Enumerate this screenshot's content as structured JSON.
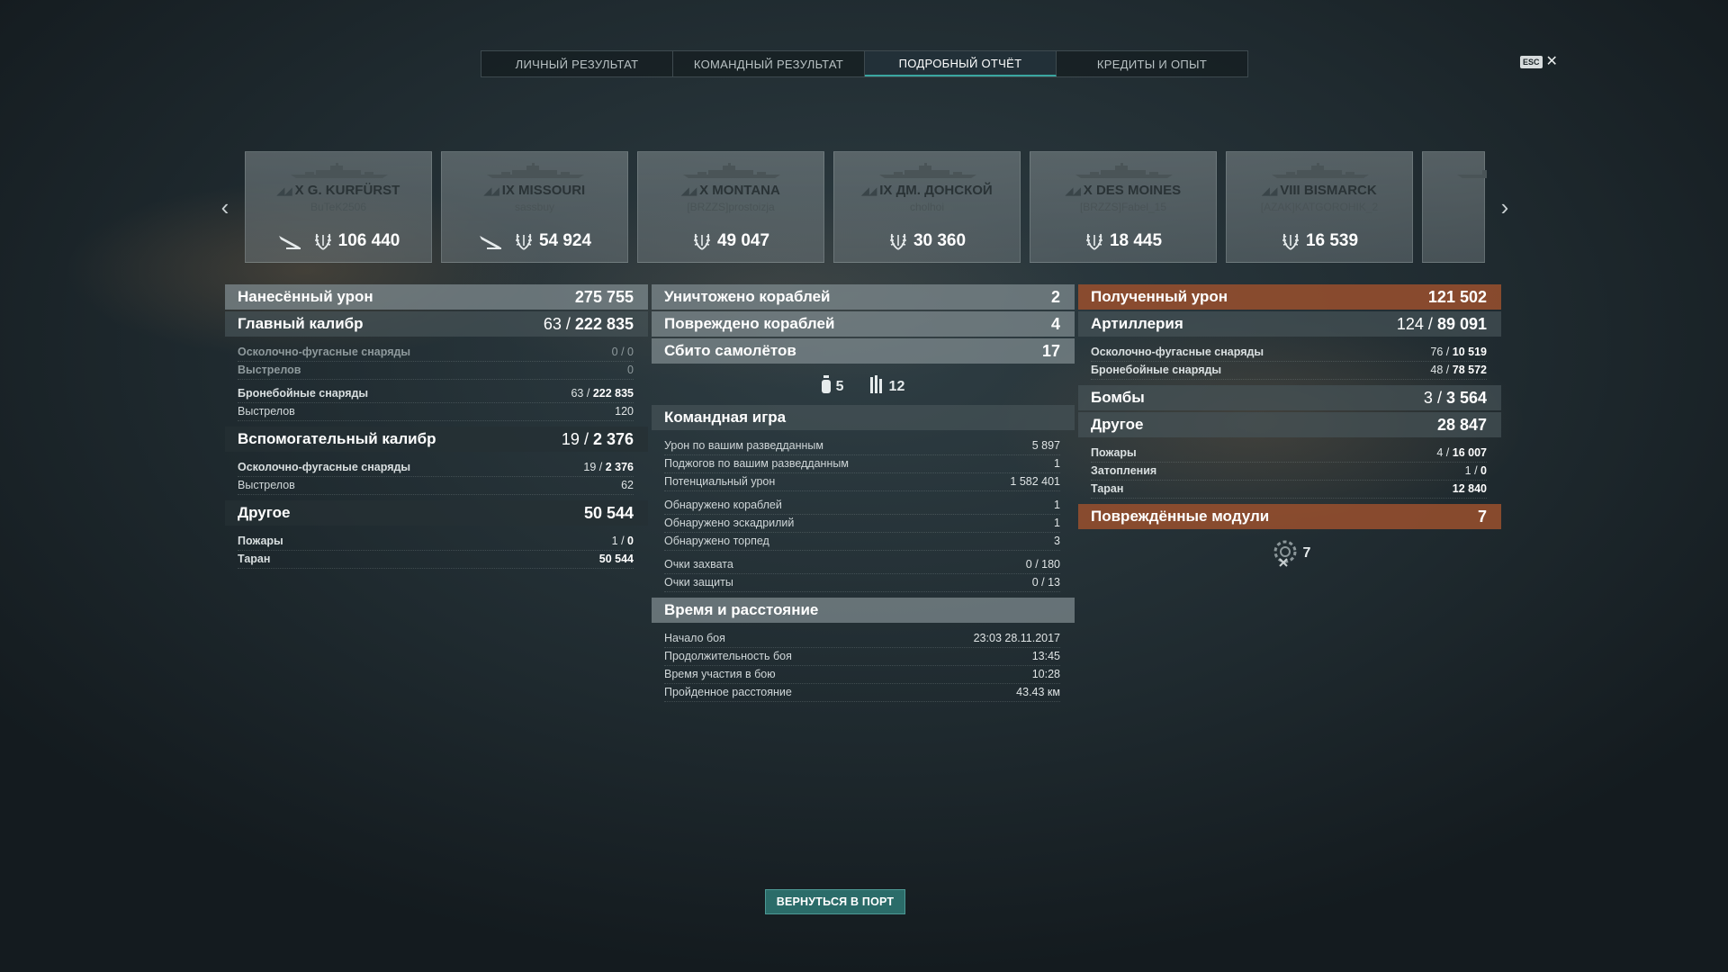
{
  "tabs": [
    {
      "label": "ЛИЧНЫЙ РЕЗУЛЬТАТ"
    },
    {
      "label": "КОМАНДНЫЙ РЕЗУЛЬТАТ"
    },
    {
      "label": "ПОДРОБНЫЙ ОТЧЁТ",
      "active": true
    },
    {
      "label": "КРЕДИТЫ И ОПЫТ"
    }
  ],
  "esc": {
    "label": "ESC",
    "close": "✕"
  },
  "nav": {
    "prev": "‹",
    "next": "›"
  },
  "ships": [
    {
      "tier": "X",
      "name": "G. KURFÜRST",
      "player": "BuTeK2506",
      "damage": "106 440",
      "plane_icon": true
    },
    {
      "tier": "IX",
      "name": "MISSOURI",
      "player": "sassbuy",
      "damage": "54 924",
      "plane_icon": true
    },
    {
      "tier": "X",
      "name": "MONTANA",
      "player": "[BRZZS]prostoizja",
      "damage": "49 047",
      "plane_icon": false
    },
    {
      "tier": "IX",
      "name": "ДМ. ДОНСКОЙ",
      "player": "cholhoi",
      "damage": "30 360",
      "plane_icon": false
    },
    {
      "tier": "X",
      "name": "DES MOINES",
      "player": "[BRZZS]Fabel_15",
      "damage": "18 445",
      "plane_icon": false
    },
    {
      "tier": "VIII",
      "name": "BISMARCK",
      "player": "[AZAK]KATGOROHIK_2",
      "damage": "16 539",
      "plane_icon": false
    }
  ],
  "dealt": {
    "title": "Нанесённый урон",
    "total": "275 755",
    "main": {
      "title": "Главный калибр",
      "hits": "63",
      "value": "222 835",
      "he_label": "Осколочно-фугасные снаряды",
      "he_value": "0 / 0",
      "he_shots_label": "Выстрелов",
      "he_shots": "0",
      "ap_label": "Бронебойные снаряды",
      "ap_hits": "63 /",
      "ap_value": "222 835",
      "ap_shots_label": "Выстрелов",
      "ap_shots": "120"
    },
    "secondary": {
      "title": "Вспомогательный калибр",
      "hits": "19",
      "value": "2 376",
      "he_label": "Осколочно-фугасные снаряды",
      "he_hits": "19 /",
      "he_value": "2 376",
      "shots_label": "Выстрелов",
      "shots": "62"
    },
    "other": {
      "title": "Другое",
      "value": "50 544",
      "fires_label": "Пожары",
      "fires_a": "1 /",
      "fires_b": "0",
      "ram_label": "Таран",
      "ram": "50 544"
    }
  },
  "middle": {
    "destroyed_label": "Уничтожено кораблей",
    "destroyed": "2",
    "damaged_label": "Повреждено кораблей",
    "damaged": "4",
    "planes_label": "Сбито самолётов",
    "planes": "17",
    "planes_a": "5",
    "planes_b": "12",
    "team": {
      "title": "Командная игра",
      "rows": [
        {
          "k": "Урон по вашим разведданным",
          "v": "5 897"
        },
        {
          "k": "Поджогов по вашим разведданным",
          "v": "1"
        },
        {
          "k": "Потенциальный урон",
          "v": "1 582 401"
        },
        {
          "k": "Обнаружено кораблей",
          "v": "1"
        },
        {
          "k": "Обнаружено эскадрилий",
          "v": "1"
        },
        {
          "k": "Обнаружено торпед",
          "v": "3"
        },
        {
          "k": "Очки захвата",
          "v": "0 / 180"
        },
        {
          "k": "Очки защиты",
          "v": "0 / 13"
        }
      ]
    },
    "time": {
      "title": "Время и расстояние",
      "rows": [
        {
          "k": "Начало боя",
          "v": "23:03  28.11.2017"
        },
        {
          "k": "Продолжительность боя",
          "v": "13:45"
        },
        {
          "k": "Время участия в бою",
          "v": "10:28"
        },
        {
          "k": "Пройденное расстояние",
          "v": "43.43 км"
        }
      ]
    }
  },
  "received": {
    "title": "Полученный урон",
    "total": "121 502",
    "artillery": {
      "title": "Артиллерия",
      "hits": "124",
      "value": "89 091",
      "he_label": "Осколочно-фугасные снаряды",
      "he_a": "76 /",
      "he_b": "10 519",
      "ap_label": "Бронебойные снаряды",
      "ap_a": "48 /",
      "ap_b": "78 572"
    },
    "bombs": {
      "title": "Бомбы",
      "hits": "3",
      "value": "3 564"
    },
    "other": {
      "title": "Другое",
      "value": "28 847",
      "fires_label": "Пожары",
      "fires_a": "4 /",
      "fires_b": "16 007",
      "flood_label": "Затопления",
      "flood_a": "1 /",
      "flood_b": "0",
      "ram_label": "Таран",
      "ram": "12 840"
    },
    "modules": {
      "title": "Повреждённые модули",
      "value": "7",
      "count": "7"
    }
  },
  "return_button": "ВЕРНУТЬСЯ В ПОРТ",
  "colors": {
    "accent": "#3aa6a0",
    "received": "#964e2d",
    "button": "#2b6c69"
  }
}
